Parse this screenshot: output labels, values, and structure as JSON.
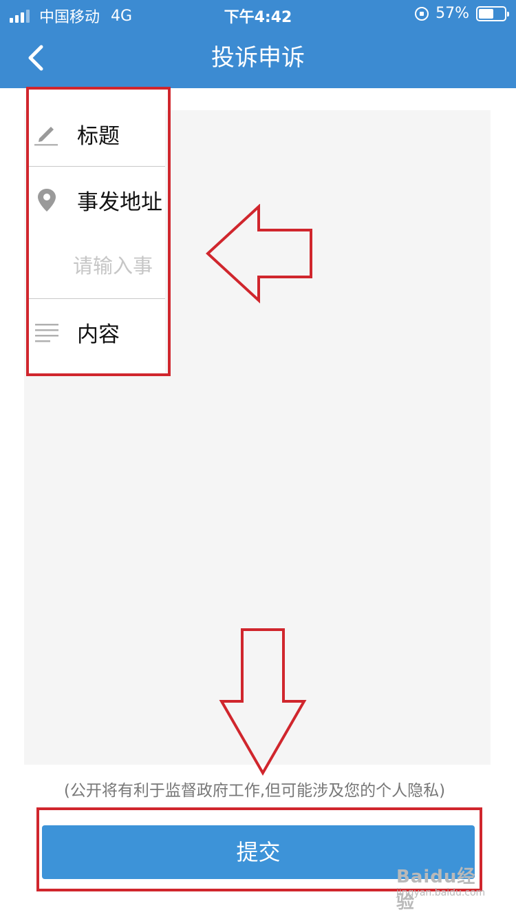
{
  "status_bar": {
    "carrier": "中国移动",
    "network": "4G",
    "time": "下午4:42",
    "battery_percent_label": "57%",
    "battery_level": 0.57,
    "icons": [
      "signal-icon",
      "orientation-lock-icon",
      "battery-icon"
    ]
  },
  "nav": {
    "title": "投诉申诉",
    "back_icon": "chevron-left-icon"
  },
  "form": {
    "title_label": "标题",
    "title_icon": "pencil-icon",
    "address_label": "事发地址",
    "address_icon": "location-pin-icon",
    "address_placeholder": "请输入事",
    "content_label": "内容",
    "content_icon": "text-lines-icon"
  },
  "note": "(公开将有利于监督政府工作,但可能涉及您的个人隐私)",
  "submit_label": "提交",
  "watermark": {
    "brand": "Baidu经验",
    "site": "jingyan.baidu.com"
  },
  "colors": {
    "header": "#3c8bd2",
    "button": "#3d93d8",
    "annotation": "#d0262d"
  }
}
